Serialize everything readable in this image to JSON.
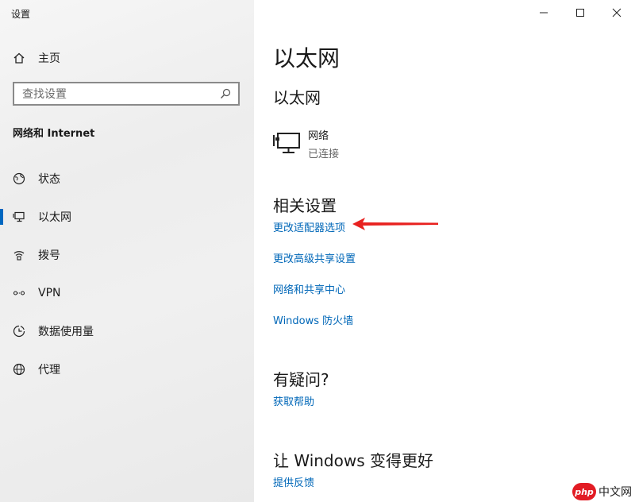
{
  "app": {
    "title": "设置"
  },
  "window_controls": {
    "minimize": "minimize-icon",
    "maximize": "maximize-icon",
    "close": "close-icon"
  },
  "sidebar": {
    "home": {
      "label": "主页",
      "icon": "home-icon"
    },
    "search": {
      "placeholder": "查找设置",
      "icon": "search-icon"
    },
    "section_title": "网络和 Internet",
    "items": [
      {
        "label": "状态",
        "icon": "globe-status-icon",
        "selected": false
      },
      {
        "label": "以太网",
        "icon": "ethernet-icon",
        "selected": true
      },
      {
        "label": "拨号",
        "icon": "dialup-icon",
        "selected": false
      },
      {
        "label": "VPN",
        "icon": "vpn-icon",
        "selected": false
      },
      {
        "label": "数据使用量",
        "icon": "data-usage-icon",
        "selected": false
      },
      {
        "label": "代理",
        "icon": "globe-icon",
        "selected": false
      }
    ]
  },
  "main": {
    "page_title": "以太网",
    "sub_title": "以太网",
    "network": {
      "name": "网络",
      "status": "已连接",
      "icon": "network-monitor-icon"
    },
    "related": {
      "heading": "相关设置",
      "links": [
        "更改适配器选项",
        "更改高级共享设置",
        "网络和共享中心",
        "Windows 防火墙"
      ]
    },
    "question": {
      "heading": "有疑问?",
      "link": "获取帮助"
    },
    "feedback": {
      "heading": "让 Windows 变得更好",
      "link": "提供反馈"
    }
  },
  "annotation": {
    "arrow_color": "#e8211f"
  },
  "watermark": {
    "badge": "php",
    "text": "中文网"
  },
  "colors": {
    "accent": "#0067c0",
    "link": "#0067b8"
  }
}
